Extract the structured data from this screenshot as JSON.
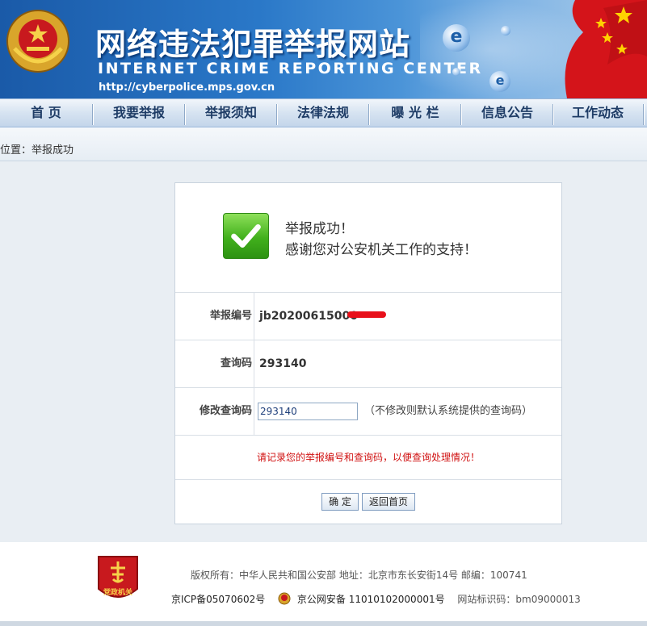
{
  "header": {
    "title_cn": "网络违法犯罪举报网站",
    "title_en": "INTERNET CRIME REPORTING CENTER",
    "url": "http://cyberpolice.mps.gov.cn"
  },
  "nav": {
    "items": [
      {
        "label": "首 页"
      },
      {
        "label": "我要举报"
      },
      {
        "label": "举报须知"
      },
      {
        "label": "法律法规"
      },
      {
        "label": "曝 光 栏"
      },
      {
        "label": "信息公告"
      },
      {
        "label": "工作动态"
      }
    ]
  },
  "breadcrumb": "位置：举报成功",
  "success": {
    "line1": "举报成功！",
    "line2": "感谢您对公安机关工作的支持！"
  },
  "form": {
    "report_no_label": "举报编号",
    "report_no_value": "jb20200615000",
    "query_code_label": "查询码",
    "query_code_value": "293140",
    "modify_label": "修改查询码",
    "modify_input_value": "293140",
    "modify_hint": "（不修改则默认系统提供的查询码）",
    "notice": "请记录您的举报编号和查询码，以便查询处理情况！",
    "confirm_label": "确 定",
    "back_label": "返回首页"
  },
  "footer": {
    "badge_text": "党政机关",
    "line1": "版权所有：中华人民共和国公安部    地址：北京市东长安街14号    邮编：100741",
    "icp": "京ICP备05070602号",
    "police_record": "京公网安备 11010102000001号",
    "site_id": "网站标识码：bm09000013"
  },
  "colors": {
    "banner": "#2a78c8",
    "notice_red": "#d01111",
    "success_green": "#41b01c"
  }
}
